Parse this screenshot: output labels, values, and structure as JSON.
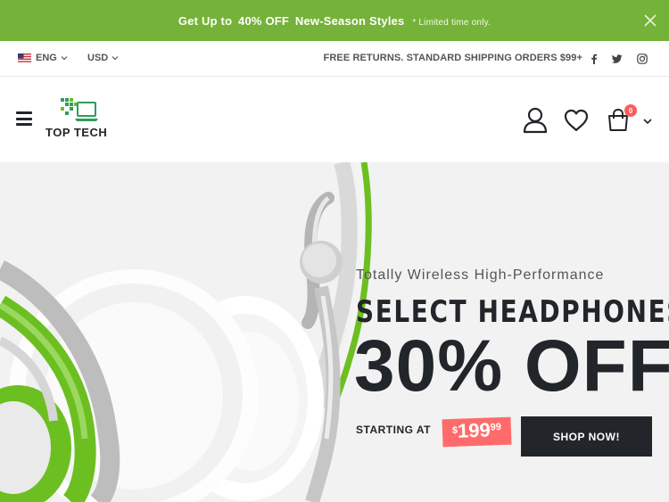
{
  "promo": {
    "prefix": "Get Up to",
    "highlight": "40% OFF",
    "suffix": "New-Season Styles",
    "note": "* Limited time only."
  },
  "topbar": {
    "language": "ENG",
    "currency": "USD",
    "shipping": "FREE RETURNS. STANDARD SHIPPING ORDERS $99+",
    "social": [
      "facebook-icon",
      "twitter-icon",
      "instagram-icon"
    ]
  },
  "header": {
    "logo_text": "TOP TECH",
    "cart_count": "0"
  },
  "hero": {
    "subtitle": "Totally Wireless High-Performance",
    "title": "SELECT HEADPHONES",
    "discount": "30% OFF",
    "starting_label": "STARTING AT",
    "price_currency": "$",
    "price_int": "199",
    "price_dec": "99",
    "button": "SHOP NOW!"
  },
  "colors": {
    "promo_bg": "#75b239",
    "dark": "#222529",
    "price_bg": "#ff6b6b",
    "hero_bg": "#f2f2f2",
    "accent_green": "#6cbf20"
  }
}
